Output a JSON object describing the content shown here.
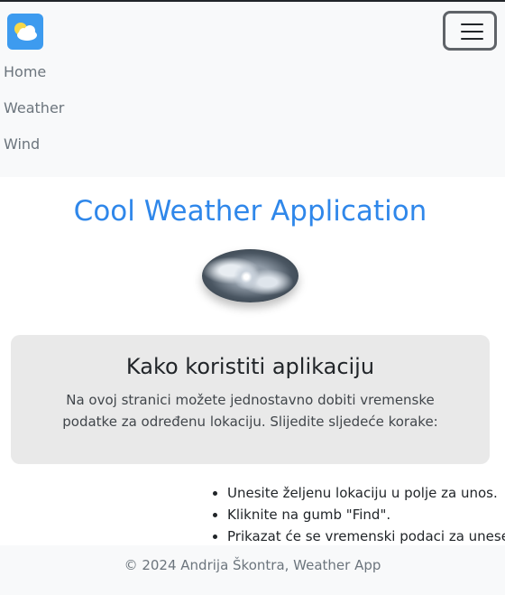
{
  "navbar": {
    "brand_icon": "weather-cloud-sun-icon",
    "toggler_icon": "hamburger-menu-icon",
    "links": [
      {
        "label": "Home"
      },
      {
        "label": "Weather"
      },
      {
        "label": "Wind"
      }
    ]
  },
  "main": {
    "title": "Cool Weather Application",
    "image": "storm-satellite-image"
  },
  "card": {
    "title": "Kako koristiti aplikaciju",
    "text": "Na ovoj stranici možete jednostavno dobiti vremenske podatke za određenu lokaciju. Slijedite sljedeće korake:"
  },
  "steps": [
    "Unesite željenu lokaciju u polje za unos.",
    "Kliknite na gumb \"Find\".",
    "Prikazat će se vremenski podaci za unesenu"
  ],
  "footer": {
    "text": "© 2024 Andrija Škontra, Weather App"
  },
  "colors": {
    "accent": "#2f87ea",
    "navbar_bg": "#f8f9fa",
    "card_bg": "#e9e9e9",
    "brand_bg": "#3d9bef"
  }
}
